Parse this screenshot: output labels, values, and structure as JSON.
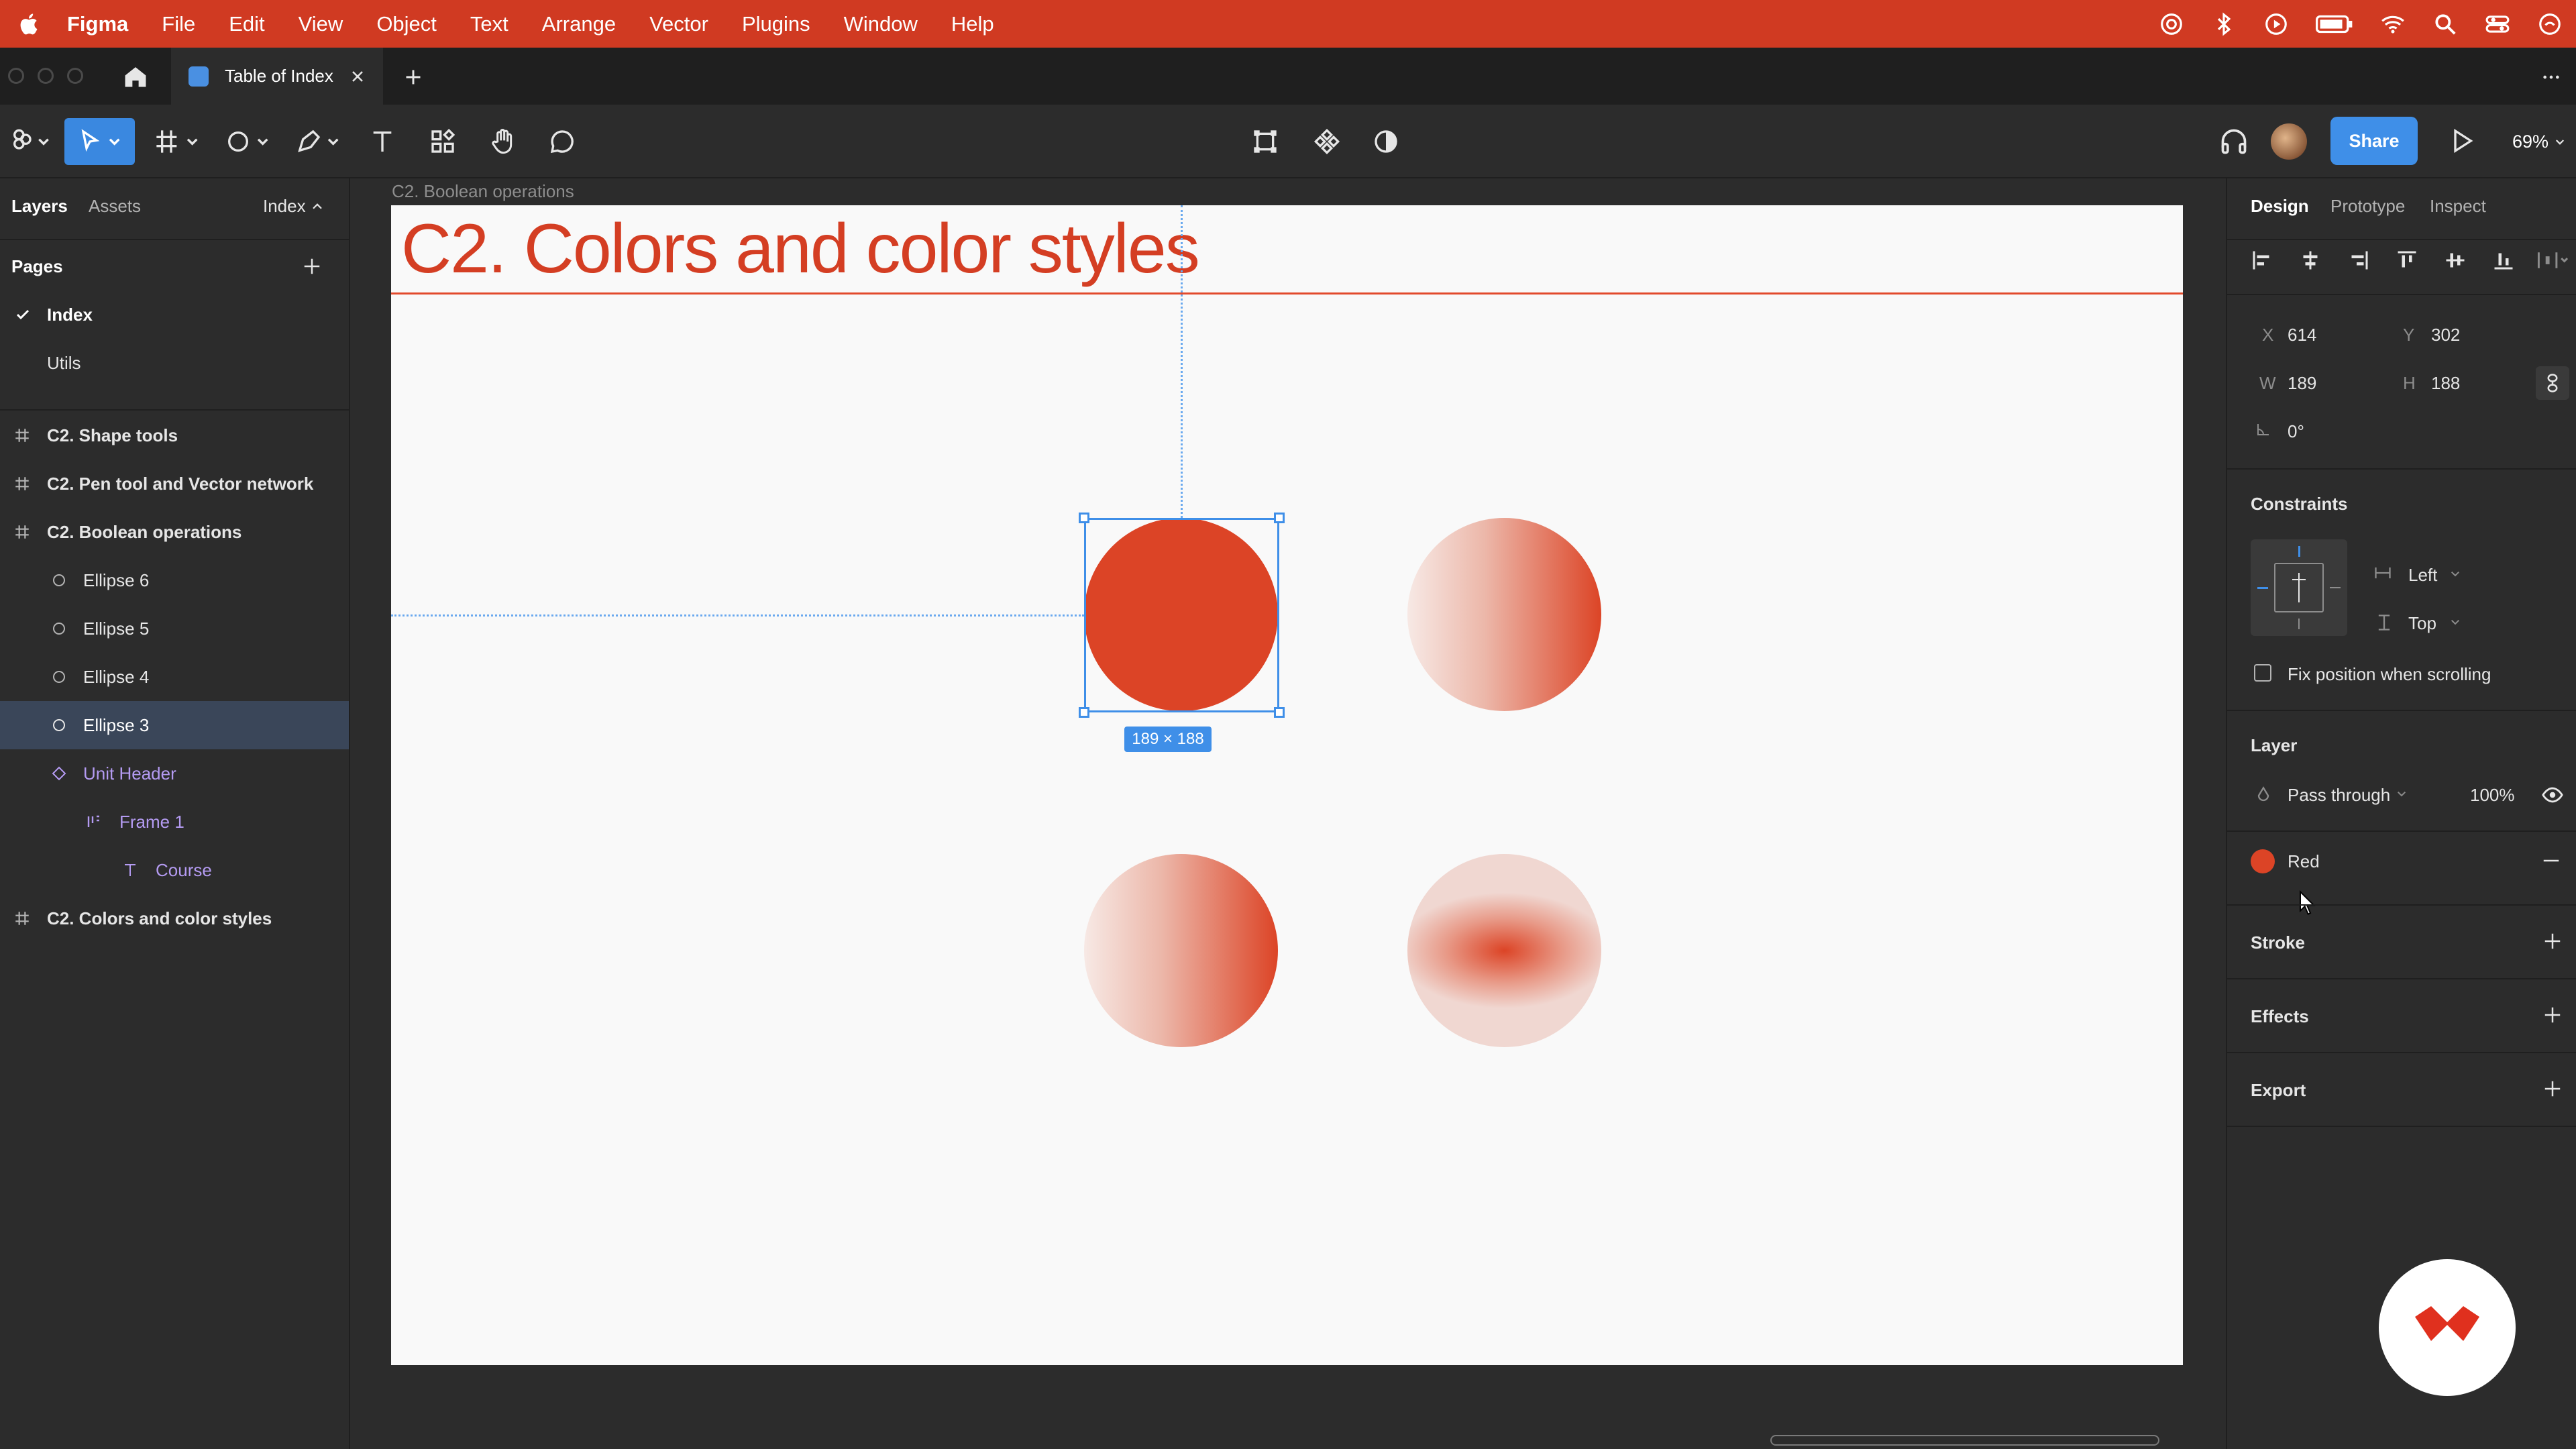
{
  "menubar": {
    "app": "Figma",
    "items": [
      "File",
      "Edit",
      "View",
      "Object",
      "Text",
      "Arrange",
      "Vector",
      "Plugins",
      "Window",
      "Help"
    ]
  },
  "tabs": {
    "active_title": "Table of Index"
  },
  "toolbar": {
    "share_label": "Share",
    "zoom": "69%"
  },
  "left_panel": {
    "tab_layers": "Layers",
    "tab_assets": "Assets",
    "page_selector": "Index",
    "pages_heading": "Pages",
    "pages": [
      {
        "label": "Index"
      },
      {
        "label": "Utils"
      }
    ],
    "layers": [
      {
        "label": "C2. Shape tools"
      },
      {
        "label": "C2. Pen tool and Vector network"
      },
      {
        "label": "C2. Boolean operations"
      },
      {
        "label": "Ellipse 6"
      },
      {
        "label": "Ellipse 5"
      },
      {
        "label": "Ellipse 4"
      },
      {
        "label": "Ellipse 3"
      },
      {
        "label": "Unit Header"
      },
      {
        "label": "Frame 1"
      },
      {
        "label": "Course"
      },
      {
        "label": "C2. Colors and color styles"
      }
    ]
  },
  "canvas": {
    "frame_label": "C2. Boolean operations",
    "header_title": "C2.  Colors and color styles",
    "size_badge": "189 × 188",
    "accent_color": "#dc4426"
  },
  "right_panel": {
    "tab_design": "Design",
    "tab_prototype": "Prototype",
    "tab_inspect": "Inspect",
    "x_label": "X",
    "x_value": "614",
    "y_label": "Y",
    "y_value": "302",
    "w_label": "W",
    "w_value": "189",
    "h_label": "H",
    "h_value": "188",
    "rotation": "0°",
    "constraints_heading": "Constraints",
    "constraint_h": "Left",
    "constraint_v": "Top",
    "fix_position": "Fix position when scrolling",
    "layer_heading": "Layer",
    "blend_mode": "Pass through",
    "opacity": "100%",
    "fill_style": "Red",
    "stroke_heading": "Stroke",
    "effects_heading": "Effects",
    "export_heading": "Export"
  }
}
